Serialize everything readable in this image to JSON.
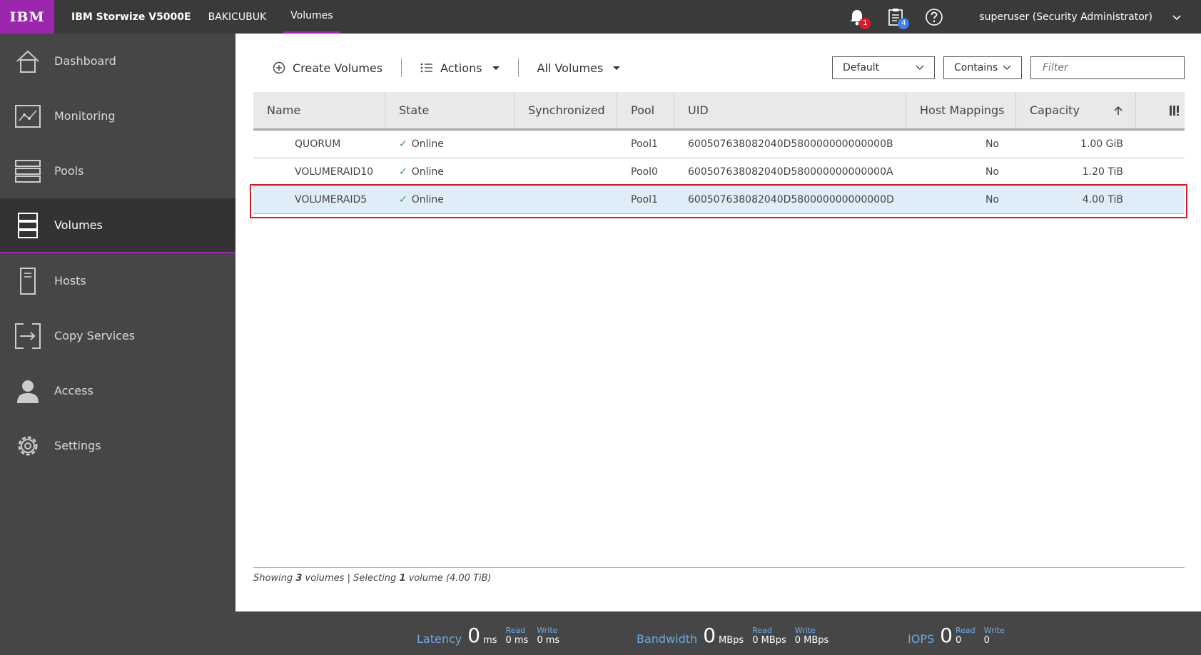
{
  "header": {
    "logo": "IBM",
    "product": "IBM Storwize V5000E",
    "system": "BAKICUBUK",
    "current_page": "Volumes",
    "notifications_count": "1",
    "tasks_count": "4",
    "user": "superuser (Security Administrator)"
  },
  "sidebar": {
    "items": [
      {
        "label": "Dashboard",
        "icon": "home-icon"
      },
      {
        "label": "Monitoring",
        "icon": "monitoring-icon"
      },
      {
        "label": "Pools",
        "icon": "pools-icon"
      },
      {
        "label": "Volumes",
        "icon": "volumes-icon"
      },
      {
        "label": "Hosts",
        "icon": "hosts-icon"
      },
      {
        "label": "Copy Services",
        "icon": "copy-services-icon"
      },
      {
        "label": "Access",
        "icon": "access-icon"
      },
      {
        "label": "Settings",
        "icon": "gear-icon"
      }
    ]
  },
  "toolbar": {
    "create_label": "Create Volumes",
    "actions_label": "Actions",
    "view_label": "All Volumes",
    "filter_mode": "Default",
    "filter_op": "Contains",
    "filter_placeholder": "Filter"
  },
  "table": {
    "columns": [
      "Name",
      "State",
      "Synchronized",
      "Pool",
      "UID",
      "Host Mappings",
      "Capacity"
    ],
    "rows": [
      {
        "name": "QUORUM",
        "state": "Online",
        "sync": "",
        "pool": "Pool1",
        "uid": "600507638082040D580000000000000B",
        "host": "No",
        "capacity": "1.00 GiB"
      },
      {
        "name": "VOLUMERAID10",
        "state": "Online",
        "sync": "",
        "pool": "Pool0",
        "uid": "600507638082040D580000000000000A",
        "host": "No",
        "capacity": "1.20 TiB"
      },
      {
        "name": "VOLUMERAID5",
        "state": "Online",
        "sync": "",
        "pool": "Pool1",
        "uid": "600507638082040D580000000000000D",
        "host": "No",
        "capacity": "4.00 TiB"
      }
    ]
  },
  "status": {
    "prefix": "Showing",
    "count": "3",
    "mid": "volumes | Selecting",
    "selected": "1",
    "suffix": "volume (4.00 TiB)"
  },
  "perf": {
    "latency": {
      "label": "Latency",
      "value": "0",
      "unit": "ms",
      "read_label": "Read",
      "read": "0 ms",
      "write_label": "Write",
      "write": "0 ms"
    },
    "bandwidth": {
      "label": "Bandwidth",
      "value": "0",
      "unit": "MBps",
      "read_label": "Read",
      "read": "0 MBps",
      "write_label": "Write",
      "write": "0 MBps"
    },
    "iops": {
      "label": "IOPS",
      "value": "0",
      "read_label": "Read",
      "read": "0",
      "write_label": "Write",
      "write": "0"
    }
  },
  "colors": {
    "accent": "#9b27af",
    "highlight": "#d21f26",
    "selected_row": "#dfedf9",
    "online": "#3c9a3c"
  }
}
